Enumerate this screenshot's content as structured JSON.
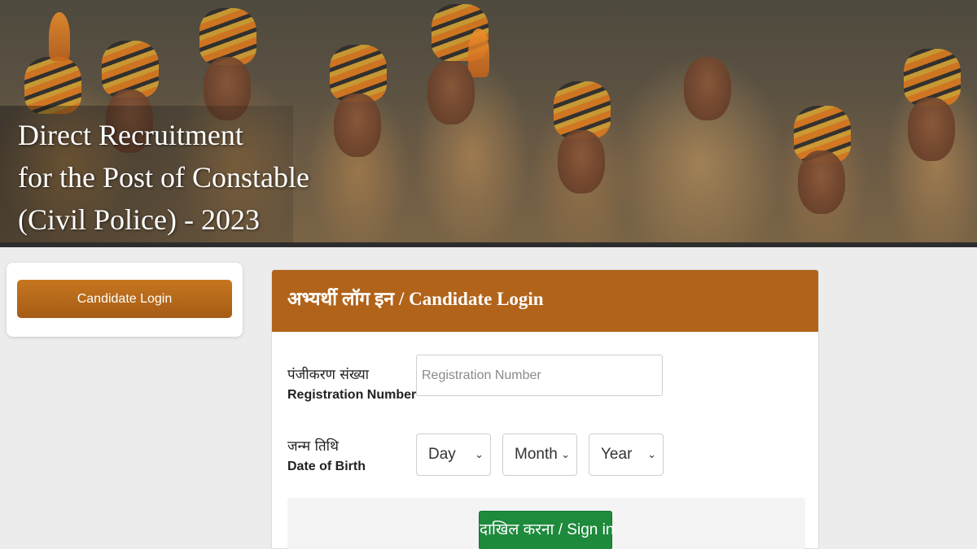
{
  "banner": {
    "title_lines": [
      "Direct Recruitment",
      "for the Post of Constable",
      "(Civil Police) - 2023"
    ]
  },
  "sidebar": {
    "login_button_label": "Candidate Login"
  },
  "login_panel": {
    "heading": "अभ्यर्थी लॉग इन / Candidate Login",
    "registration": {
      "label_hindi": "पंजीकरण संख्या",
      "label_english": "Registration Number",
      "placeholder": "Registration Number",
      "value": ""
    },
    "dob": {
      "label_hindi": "जन्म तिथि",
      "label_english": "Date of Birth",
      "day_selected": "Day",
      "month_selected": "Month",
      "year_selected": "Year"
    },
    "submit_label": "दाखिल करना / Sign in"
  },
  "colors": {
    "panel_header": "#b1631a",
    "sidebar_button": "#b56a1b",
    "submit_button": "#1e8a3c"
  },
  "icons": {
    "select_arrow": "chevron-down-icon"
  }
}
